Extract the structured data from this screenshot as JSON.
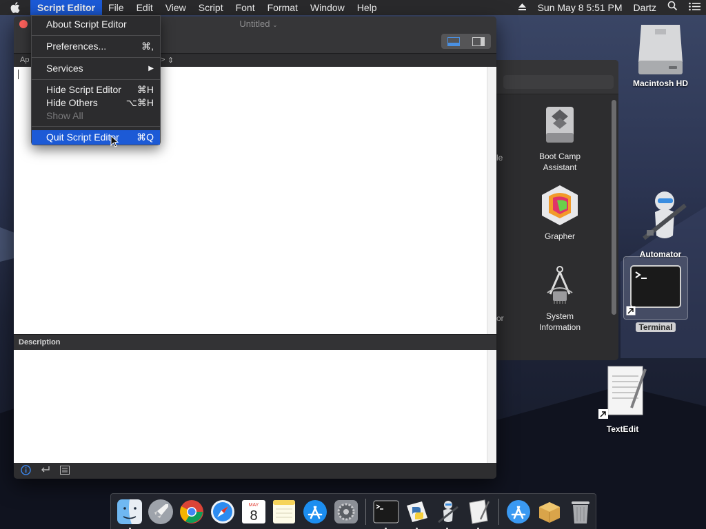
{
  "menubar": {
    "apple": "apple-icon",
    "app_name": "Script Editor",
    "items": [
      "File",
      "Edit",
      "View",
      "Script",
      "Font",
      "Format",
      "Window",
      "Help"
    ],
    "clock": "Sun May 8  5:51 PM",
    "user": "Dartz"
  },
  "app_menu": {
    "about": "About Script Editor",
    "preferences": "Preferences...",
    "preferences_sc": "⌘,",
    "services": "Services",
    "hide": "Hide Script Editor",
    "hide_sc": "⌘H",
    "hide_others": "Hide Others",
    "hide_others_sc": "⌥⌘H",
    "show_all": "Show All",
    "quit": "Quit Script Editor",
    "quit_sc": "⌘Q"
  },
  "script_editor": {
    "title": "Untitled",
    "nav_left": "Ap",
    "nav_right": ">",
    "description_label": "Description"
  },
  "apps_window": {
    "partial_1": "le",
    "partial_2": "or",
    "items": [
      {
        "label": "Boot Camp Assistant",
        "icon": "boot-camp-icon"
      },
      {
        "label": "Grapher",
        "icon": "grapher-icon"
      },
      {
        "label": "System Information",
        "icon": "system-information-icon"
      }
    ]
  },
  "desktop": {
    "macintosh_hd": "Macintosh HD",
    "automator": "Automator",
    "terminal": "Terminal",
    "textedit": "TextEdit"
  },
  "dock": {
    "calendar_month": "MAY",
    "calendar_day": "8"
  }
}
